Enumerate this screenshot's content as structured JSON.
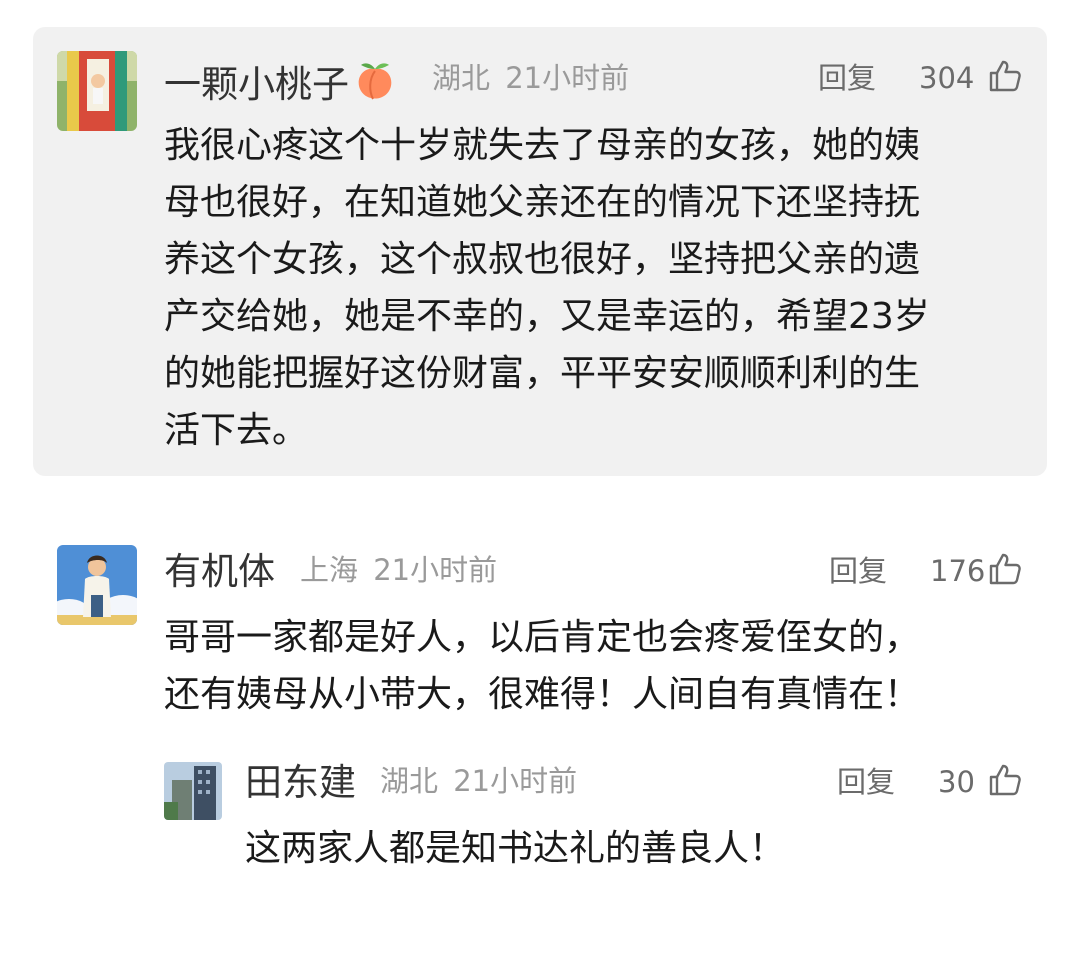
{
  "comments": [
    {
      "username": "一颗小桃子",
      "user_badge_icon": "peach-emoji",
      "location": "湖北",
      "time": "21小时前",
      "reply_label": "回复",
      "likes": "304",
      "text": [
        "我很心疼这个十岁就失去了母亲的女孩，她的姨",
        "母也很好，在知道她父亲还在的情况下还坚持抚",
        "养这个女孩，这个叔叔也很好，坚持把父亲的遗",
        "产交给她，她是不幸的，又是幸运的，希望23岁",
        "的她能把握好这份财富，平平安安顺顺利利的生",
        "活下去。"
      ]
    },
    {
      "username": "有机体",
      "location": "上海",
      "time": "21小时前",
      "reply_label": "回复",
      "likes": "176",
      "text": [
        "哥哥一家都是好人，以后肯定也会疼爱侄女的，",
        "还有姨母从小带大，很难得！人间自有真情在！"
      ],
      "replies": [
        {
          "username": "田东建",
          "location": "湖北",
          "time": "21小时前",
          "reply_label": "回复",
          "likes": "30",
          "text": [
            "这两家人都是知书达礼的善良人！"
          ]
        }
      ]
    }
  ],
  "colors": {
    "highlight_bg": "#f1f1f1",
    "username": "#333333",
    "meta": "#9a9a9a",
    "action": "#6b6b6b",
    "body": "#1a1a1a"
  },
  "icons": [
    "thumbs-up-icon",
    "peach-emoji",
    "avatar"
  ]
}
